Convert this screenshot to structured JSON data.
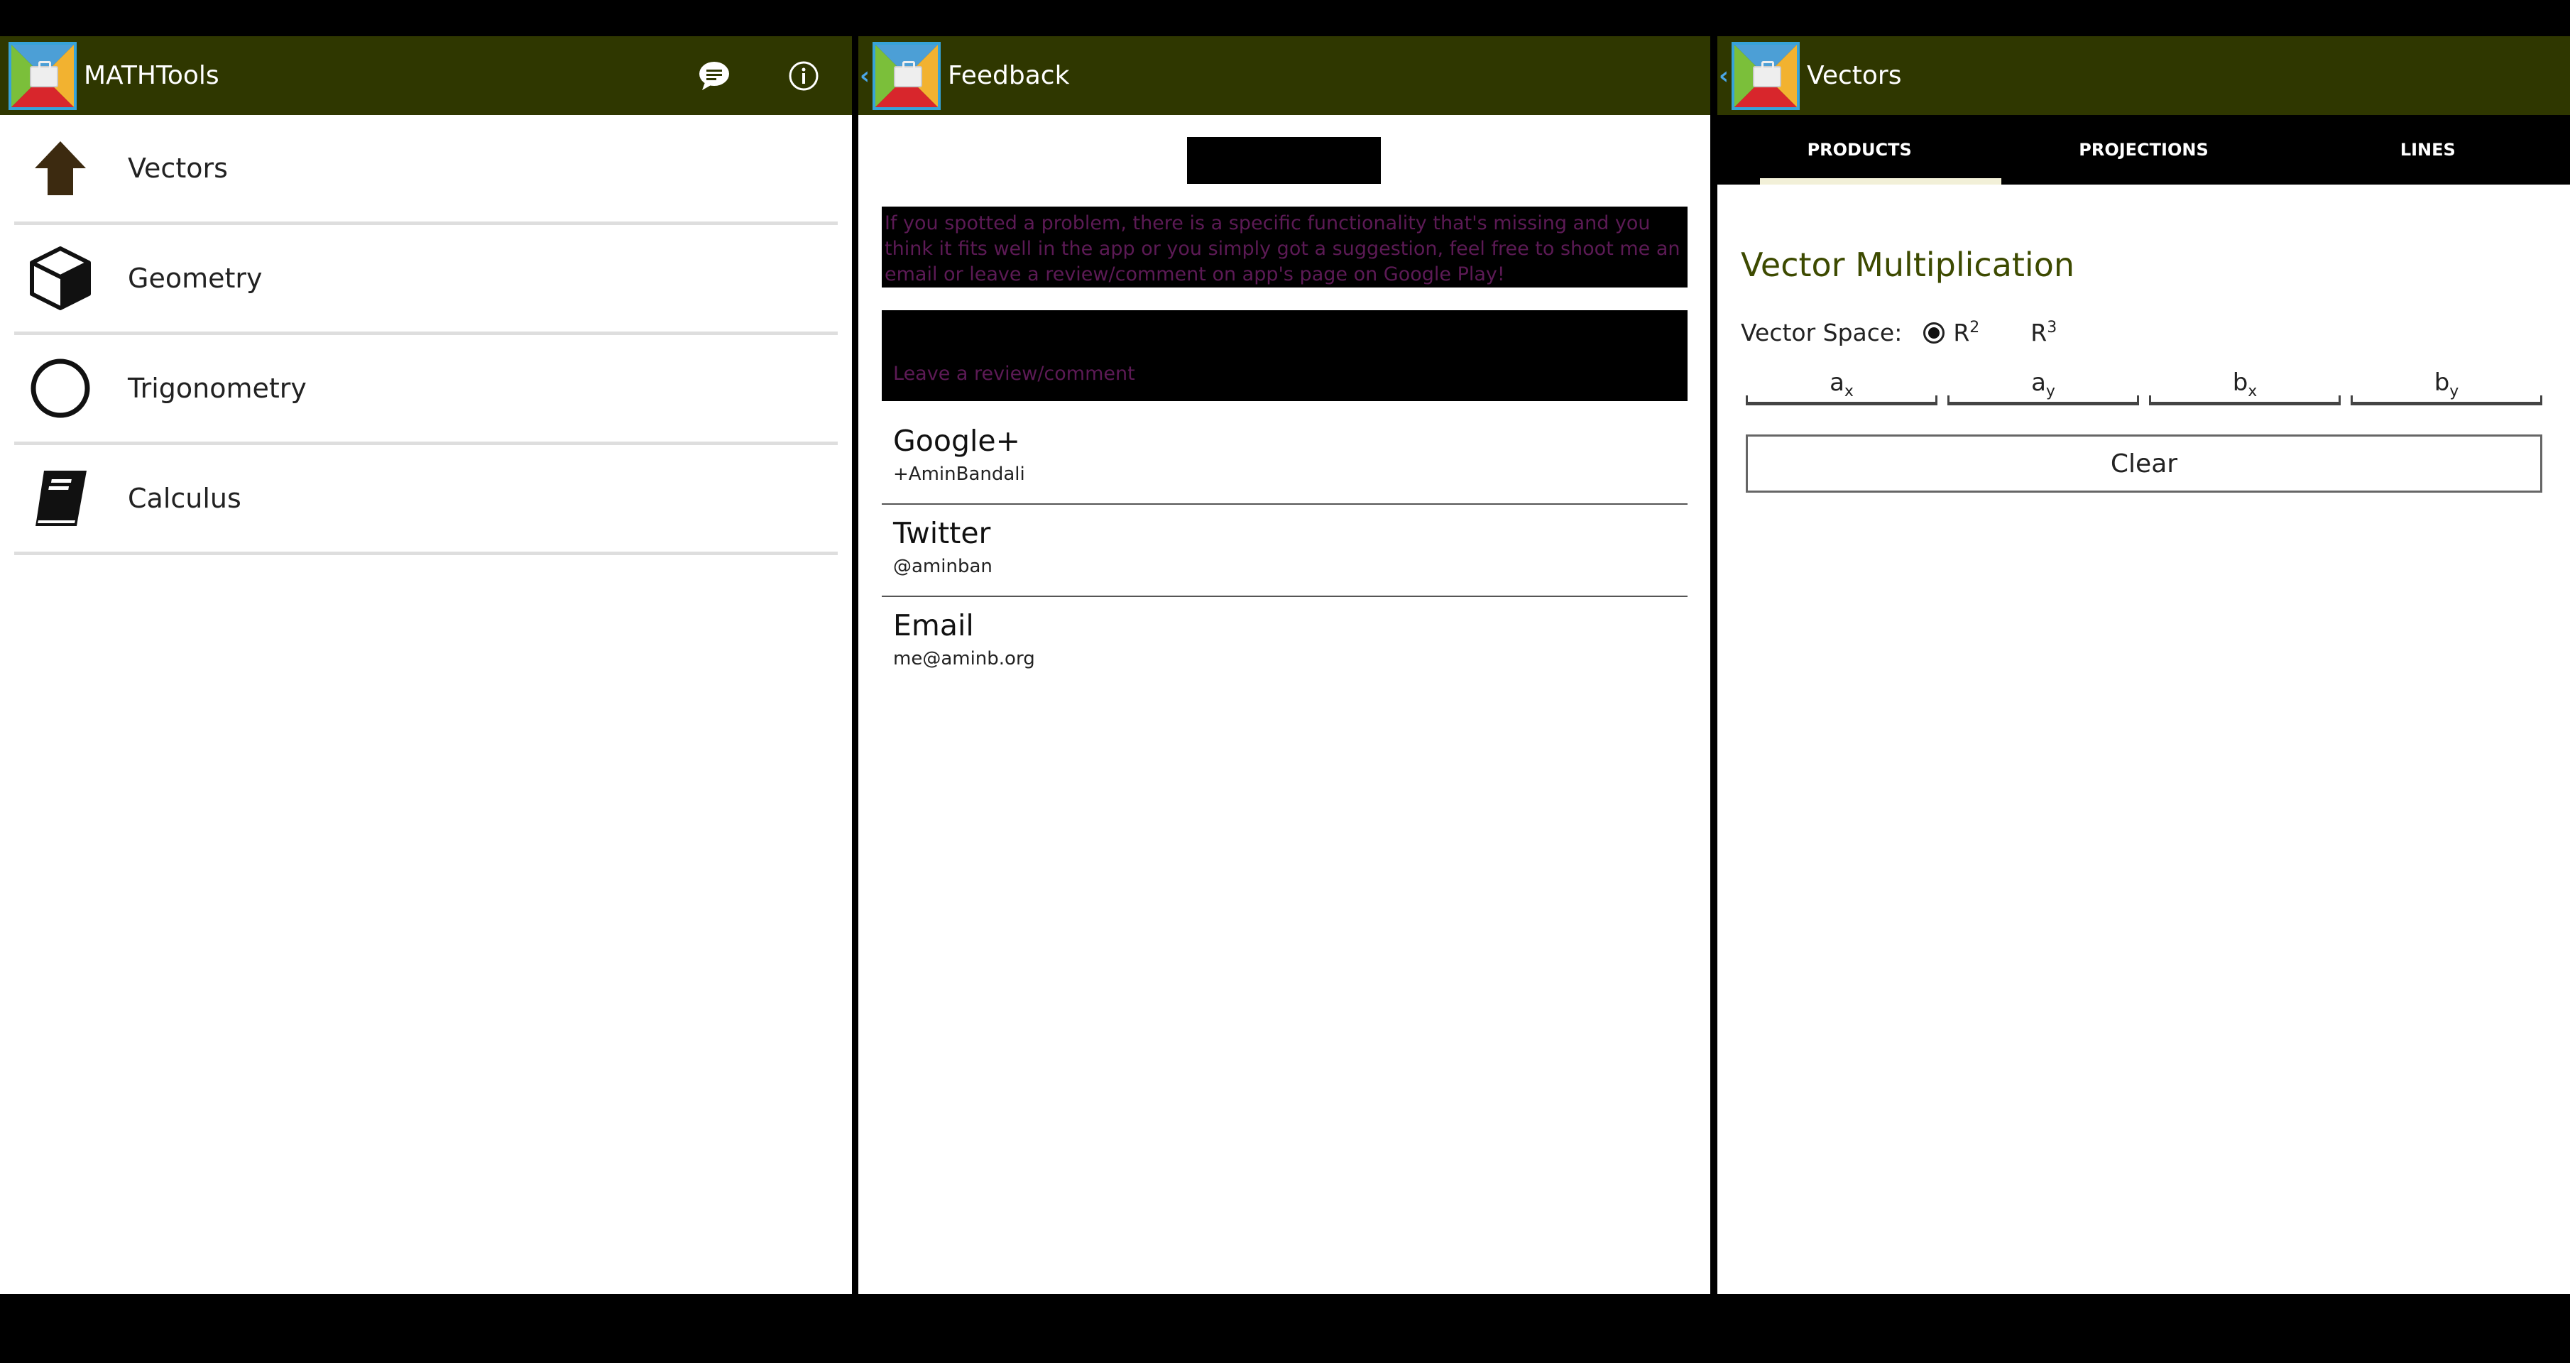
{
  "panel1": {
    "title": "MATHTools",
    "menu": [
      {
        "label": "Vectors",
        "icon": "up-arrow-icon"
      },
      {
        "label": "Geometry",
        "icon": "cube-icon"
      },
      {
        "label": "Trigonometry",
        "icon": "circle-icon"
      },
      {
        "label": "Calculus",
        "icon": "book-icon"
      }
    ],
    "actions": [
      "feedback-chat-icon",
      "info-icon"
    ]
  },
  "panel2": {
    "title": "Feedback",
    "description": "If you spotted a problem, there is a specific functionality that's missing and you think it fits well in the app or you simply got a suggestion, feel free to shoot me an email or leave a review/comment on app's page on Google Play!",
    "review_label": "Leave a review/comment",
    "contacts": [
      {
        "name": "Google+",
        "value": "+AminBandali"
      },
      {
        "name": "Twitter",
        "value": "@aminban"
      },
      {
        "name": "Email",
        "value": "me@aminb.org"
      }
    ]
  },
  "panel3": {
    "title": "Vectors",
    "tabs": [
      "PRODUCTS",
      "PROJECTIONS",
      "LINES"
    ],
    "heading": "Vector Multiplication",
    "vector_space_label": "Vector Space:",
    "r2": "R",
    "r2_exp": "2",
    "r3": "R",
    "r3_exp": "3",
    "inputs": [
      {
        "base": "a",
        "sub": "x"
      },
      {
        "base": "a",
        "sub": "y"
      },
      {
        "base": "b",
        "sub": "x"
      },
      {
        "base": "b",
        "sub": "y"
      }
    ],
    "clear_label": "Clear"
  },
  "colors": {
    "actionbar": "#2f3700",
    "heading": "#3d4a00",
    "dark_text": "#5c1a55"
  }
}
